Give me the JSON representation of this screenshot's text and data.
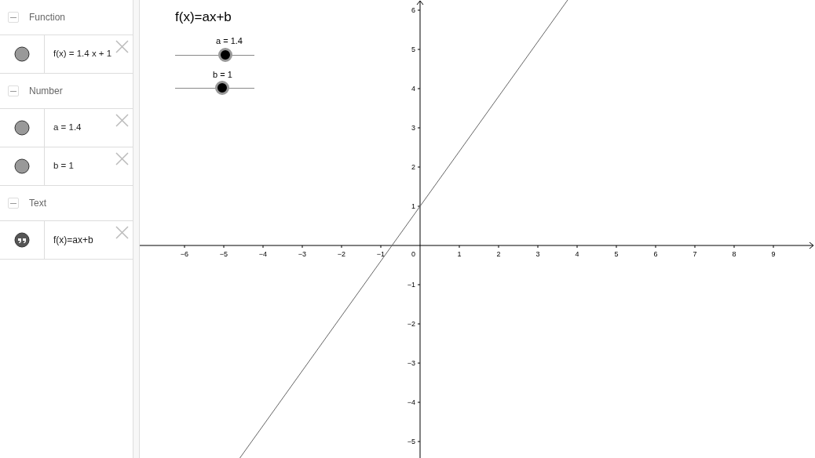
{
  "algebra": {
    "groups": [
      {
        "title": "Function",
        "expanded": true,
        "items": [
          {
            "kind": "object",
            "visible": true,
            "text": "f(x) = 1.4 x + 1"
          }
        ]
      },
      {
        "title": "Number",
        "expanded": true,
        "items": [
          {
            "kind": "object",
            "visible": true,
            "text": "a = 1.4"
          },
          {
            "kind": "object",
            "visible": true,
            "text": "b = 1"
          }
        ]
      },
      {
        "title": "Text",
        "expanded": true,
        "items": [
          {
            "kind": "text",
            "visible": true,
            "text": "f(x)=ax+b"
          }
        ]
      }
    ]
  },
  "graphics": {
    "text": "f(x)=ax+b",
    "sliders": [
      {
        "label": "a = 1.4",
        "level": 0.64
      },
      {
        "label": "b = 1",
        "level": 0.6
      }
    ],
    "origin_label": "0",
    "chart_data": {
      "type": "line",
      "x": [
        -4.59,
        3.76
      ],
      "series": [
        {
          "color": "#666666",
          "values": [
            -5.42,
            6.26
          ]
        }
      ],
      "xlim": [
        -7.14,
        10.06
      ],
      "ylim": [
        -5.42,
        6.26
      ],
      "xticks": [
        -6,
        -5,
        -4,
        -3,
        -2,
        -1,
        1,
        2,
        3,
        4,
        5,
        6,
        7,
        8,
        9
      ],
      "yticks": [
        -5,
        -4,
        -3,
        -2,
        -1,
        1,
        2,
        3,
        4,
        5,
        6
      ]
    }
  }
}
